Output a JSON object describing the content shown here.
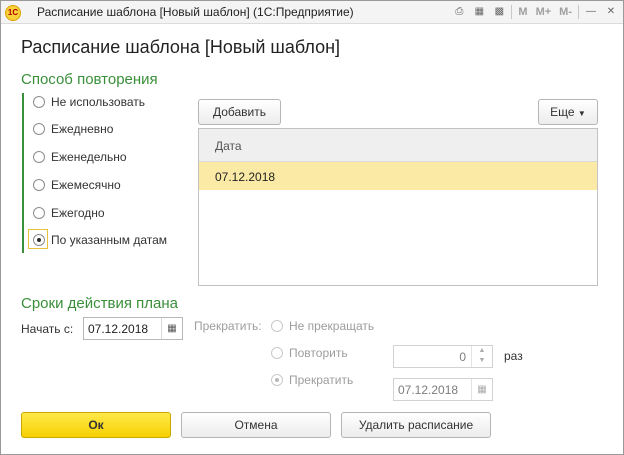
{
  "window": {
    "title": "Расписание шаблона [Новый шаблон]  (1С:Предприятие)",
    "logo": "1С",
    "toolbar": {
      "m": "M",
      "m_plus": "M+",
      "m_minus": "M-"
    }
  },
  "form": {
    "title": "Расписание шаблона [Новый шаблон]"
  },
  "repeat": {
    "title": "Способ повторения",
    "options": [
      "Не использовать",
      "Ежедневно",
      "Еженедельно",
      "Ежемесячно",
      "Ежегодно",
      "По указанным датам"
    ],
    "selected_index": 5
  },
  "dates": {
    "add_label": "Добавить",
    "more_label": "Еще",
    "column_header": "Дата",
    "rows": [
      "07.12.2018"
    ]
  },
  "plan": {
    "title": "Сроки действия плана",
    "start_label": "Начать с:",
    "start_value": "07.12.2018",
    "stop_label": "Прекратить:",
    "stop_options": [
      "Не прекращать",
      "Повторить",
      "Прекратить"
    ],
    "stop_selected_index": 2,
    "repeat_count": "0",
    "repeat_unit": "раз",
    "stop_date": "07.12.2018"
  },
  "footer": {
    "ok_label": "Ок",
    "cancel_label": "Отмена",
    "delete_label": "Удалить расписание"
  }
}
